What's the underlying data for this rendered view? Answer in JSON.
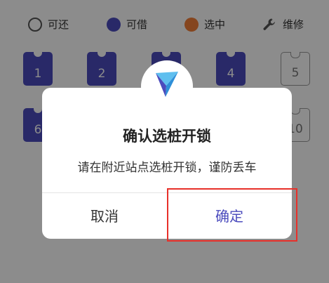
{
  "legend": {
    "available": "可还",
    "borrow": "可借",
    "selected": "选中",
    "repair": "维修"
  },
  "slots": [
    "1",
    "2",
    "4",
    "5",
    "6",
    "10"
  ],
  "dialog": {
    "title": "确认选桩开锁",
    "message": "请在附近站点选桩开锁，谨防丢车",
    "cancel": "取消",
    "confirm": "确定"
  },
  "colors": {
    "borrow": "#4b4bbd",
    "selected": "#f37e37",
    "highlight": "#e8302a"
  },
  "icons": {
    "repair": "wrench-icon",
    "logo": "paper-plane-icon"
  }
}
